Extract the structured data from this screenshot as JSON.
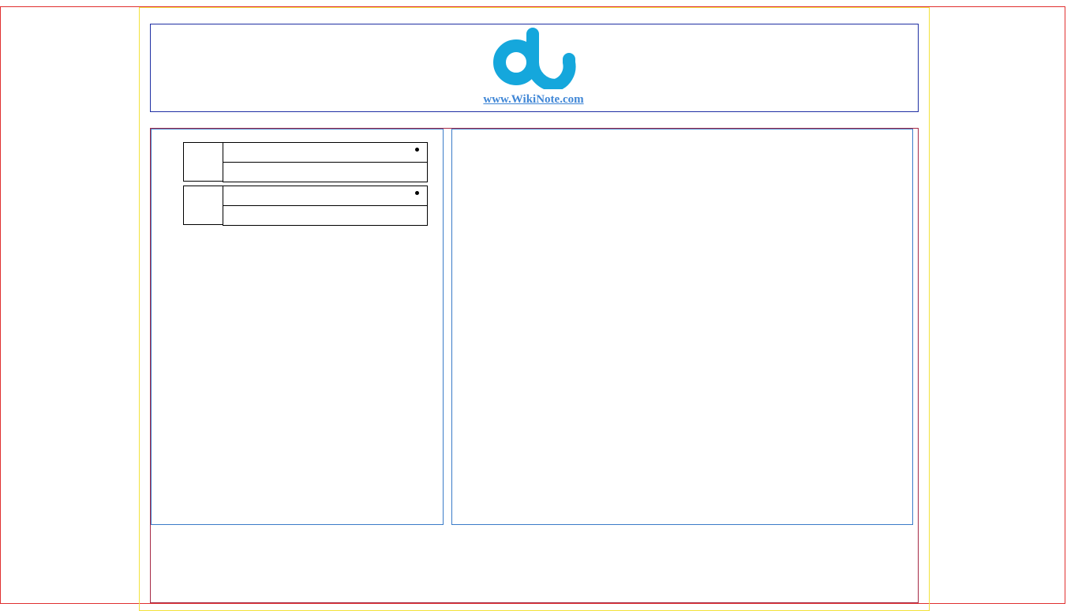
{
  "header": {
    "logo_icon": "du-logo-icon",
    "logo_color": "#15a7dc",
    "site_link": "www.WikiNote.com"
  },
  "sidebar": {
    "items": [
      {
        "title": "",
        "subtitle": "",
        "bullet_icon": "bullet-icon"
      },
      {
        "title": "",
        "subtitle": "",
        "bullet_icon": "bullet-icon"
      }
    ]
  },
  "main": {
    "content": ""
  }
}
